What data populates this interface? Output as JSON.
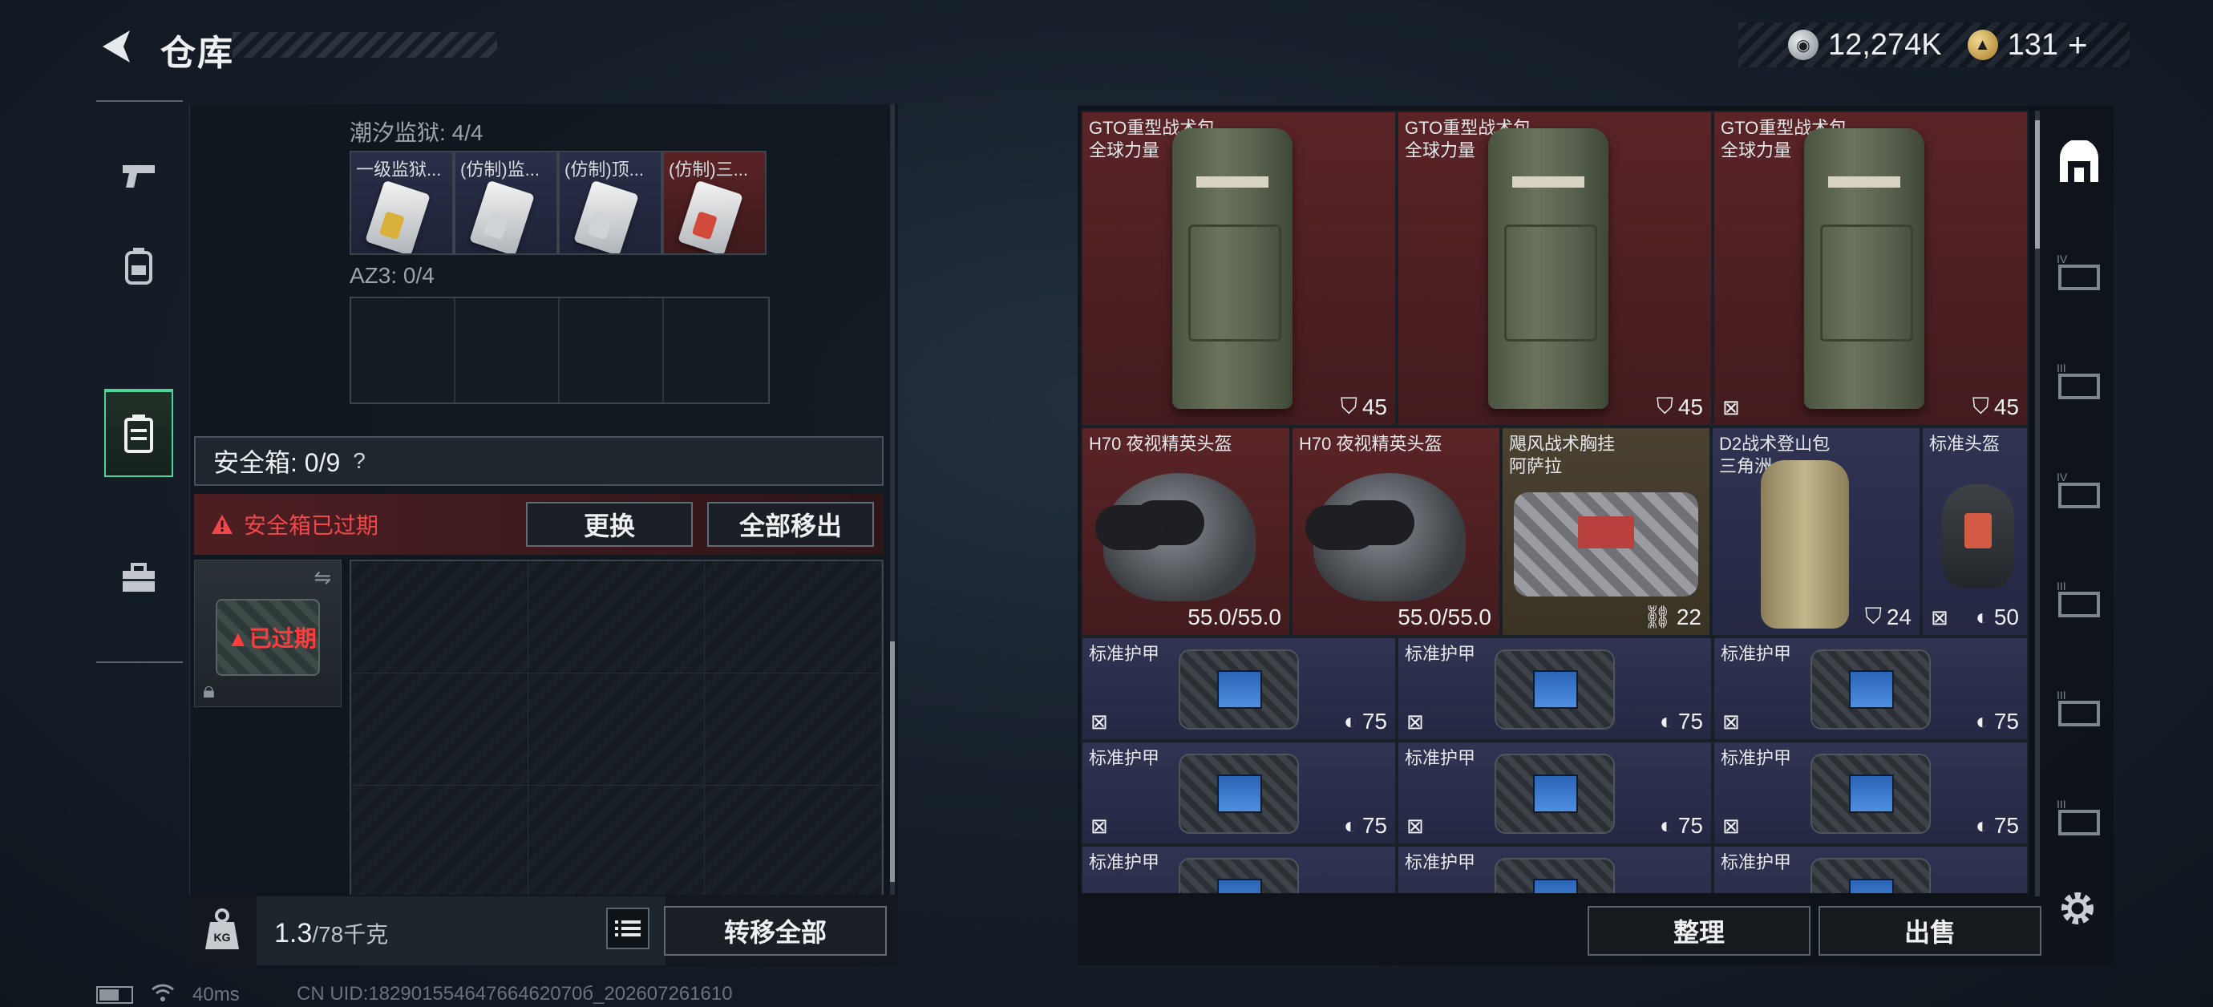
{
  "header": {
    "title": "仓库",
    "currency_silver": "12,274K",
    "currency_gold": "131",
    "add_label": "+"
  },
  "leftnav": {
    "items": [
      {
        "name": "weapons",
        "icon": "pistol-icon",
        "glyph": "⌐"
      },
      {
        "name": "equipment",
        "icon": "backpack-icon",
        "glyph": "▣"
      },
      {
        "name": "safebox",
        "icon": "safebox-icon",
        "glyph": "▤"
      },
      {
        "name": "toolbox",
        "icon": "toolbox-icon",
        "glyph": "⊞"
      }
    ],
    "active": 2
  },
  "prison": {
    "label": "潮汐监狱: 4/4",
    "slots": [
      {
        "label": "一级监狱...",
        "chip": "#d9b13a"
      },
      {
        "label": "(仿制)监...",
        "chip": "#c8cbd0"
      },
      {
        "label": "(仿制)顶...",
        "chip": "#c8cbd0"
      },
      {
        "label": "(仿制)三...",
        "chip": "#d24a3c"
      }
    ]
  },
  "az3": {
    "label": "AZ3: 0/4"
  },
  "safebox": {
    "title": "安全箱: 0/9",
    "help": "?",
    "warning": "安全箱已过期",
    "replace_label": "更换",
    "move_all_out_label": "全部移出",
    "expired_label": "已过期"
  },
  "footer_left": {
    "weight_value": "1.3",
    "weight_unit": "/78千克",
    "transfer_all_label": "转移全部",
    "kg_label": "KG"
  },
  "inventory": {
    "row1": [
      {
        "name": "GTO重型战术包",
        "sub": "全球力量",
        "stat": "45",
        "stat_icon": "capacity-icon",
        "no_insure": false
      },
      {
        "name": "GTO重型战术包",
        "sub": "全球力量",
        "stat": "45",
        "stat_icon": "capacity-icon",
        "no_insure": false
      },
      {
        "name": "GTO重型战术包",
        "sub": "全球力量",
        "stat": "45",
        "stat_icon": "capacity-icon",
        "no_insure": true
      }
    ],
    "row2": [
      {
        "name": "H70 夜视精英头盔",
        "sub": "",
        "stat": "55.0/55.0"
      },
      {
        "name": "H70 夜视精英头盔",
        "sub": "",
        "stat": "55.0/55.0"
      },
      {
        "name": "飓风战术胸挂",
        "sub": "阿萨拉",
        "stat": "22"
      },
      {
        "name": "D2战术登山包",
        "sub": "三角洲",
        "stat": "24"
      },
      {
        "name": "标准头盔",
        "sub": "",
        "stat": "50"
      }
    ],
    "armor_name": "标准护甲",
    "armor_stat": "75"
  },
  "actions": {
    "sort_label": "整理",
    "sell_label": "出售"
  },
  "status": {
    "ping": "40ms",
    "uid": "CN UID:18290155464766462070б_202607261610"
  }
}
